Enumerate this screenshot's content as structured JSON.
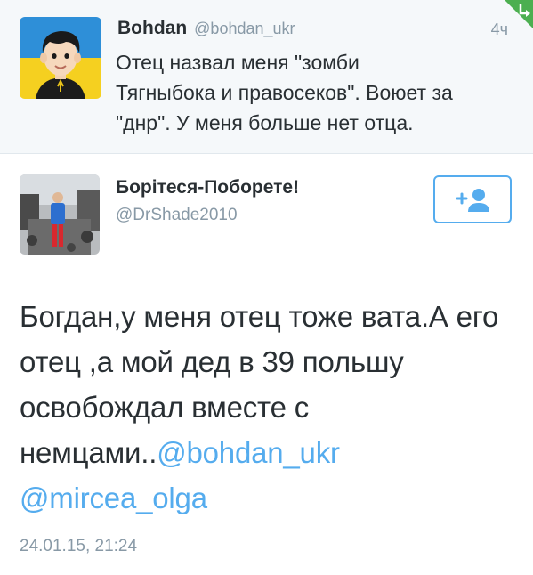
{
  "parent_tweet": {
    "author_name": "Bohdan",
    "author_handle": "@bohdan_ukr",
    "time": "4ч",
    "text_lines": [
      "Отец назвал меня \"зомби",
      "Тягныбока и правосеков\". Воюет за",
      "\"днр\". У меня больше нет отца."
    ],
    "avatar_icon": "cartoon-boy-ukraine-flag-avatar"
  },
  "tweet": {
    "author_name": "Борітеся-Поборете!",
    "author_handle": "@DrShade2010",
    "avatar_icon": "person-photo-avatar",
    "follow_icon": "add-user-icon",
    "text_before_mentions": "Богдан,у меня отец тоже вата.А его отец ,а мой дед в 39 польшу освобождал вместе с немцами..",
    "mention_1": "@bohdan_ukr",
    "mention_2": "@mircea_olga",
    "date": "24.01.15, 21:24"
  },
  "colors": {
    "accent": "#55acee",
    "muted_text": "#8899a6",
    "primary_text": "#292f33",
    "parent_background": "#f5f8fa",
    "corner_badge": "#4caf50"
  }
}
